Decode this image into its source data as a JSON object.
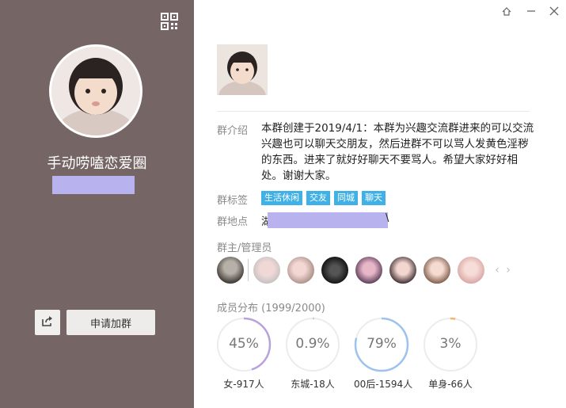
{
  "colors": {
    "left_panel": "#756665",
    "tag_bg": "#3fb1e6",
    "redaction": "#b8b2ee"
  },
  "left": {
    "group_name": "手动唠嗑恋爱圈",
    "apply_button": "申请加群",
    "icons": {
      "qr": "qr-code-icon",
      "share": "share-icon"
    }
  },
  "window": {
    "icons": [
      "pin-icon",
      "minimize-icon",
      "close-icon"
    ]
  },
  "info": {
    "intro_label": "群介绍",
    "intro_text": "本群创建于2019/4/1：本群为兴趣交流群进来的可以交流兴趣也可以聊天交朋友，然后进群不可以骂人发黄色淫秽的东西。进来了就好好聊天不要骂人。希望大家好好相处。谢谢大家。",
    "tags_label": "群标签",
    "tags": [
      "生活休闲",
      "交友",
      "同城",
      "聊天"
    ],
    "location_label": "群地点",
    "location_visible_start": "湖",
    "location_visible_end": "\\",
    "admins_label": "群主/管理员",
    "members_label": "成员分布 (1999/2000)"
  },
  "stats": [
    {
      "pct": "45%",
      "value": 0.45,
      "caption": "女-917人",
      "color": "#b9a2dc"
    },
    {
      "pct": "0.9%",
      "value": 0.009,
      "caption": "东城-18人",
      "color": "#cccccc"
    },
    {
      "pct": "79%",
      "value": 0.79,
      "caption": "00后-1594人",
      "color": "#9ec2ee"
    },
    {
      "pct": "3%",
      "value": 0.03,
      "caption": "单身-66人",
      "color": "#f6b46a"
    }
  ]
}
